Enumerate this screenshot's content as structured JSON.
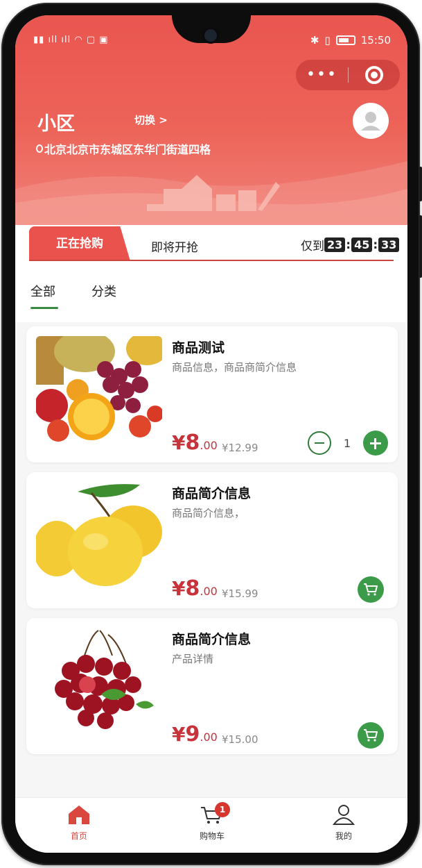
{
  "status_bar": {
    "time": "15:50"
  },
  "header": {
    "community": "小区",
    "switch_label": "切换 >",
    "address": "北京北京市东城区东华门街道四格"
  },
  "capsule": {
    "menu_icon": "more-dots-icon",
    "close_icon": "target-circle-icon"
  },
  "tabs": {
    "active": "正在抢购",
    "upcoming": "即将开抢",
    "countdown_prefix": "仅到",
    "hours": "23",
    "minutes": "45",
    "seconds": "33"
  },
  "categories": {
    "all": "全部",
    "classify": "分类"
  },
  "products": [
    {
      "name": "商品测试",
      "desc": "商品信息，商品商简介信息",
      "price_int": "8",
      "price_dec": ".00",
      "orig": "¥12.99",
      "qty": "1",
      "image": "mixed-fruit"
    },
    {
      "name": "商品简介信息",
      "desc": "商品简介信息，",
      "price_int": "8",
      "price_dec": ".00",
      "orig": "¥15.99",
      "image": "lemons"
    },
    {
      "name": "商品简介信息",
      "desc": "产品详情",
      "price_int": "9",
      "price_dec": ".00",
      "orig": "¥15.00",
      "image": "cherries"
    }
  ],
  "currency": "¥",
  "nav": {
    "home": "首页",
    "cart": "购物车",
    "cart_badge": "1",
    "mine": "我的"
  },
  "colors": {
    "primary_red": "#e9524d",
    "green": "#3b9b49",
    "price_red": "#c7323b"
  }
}
